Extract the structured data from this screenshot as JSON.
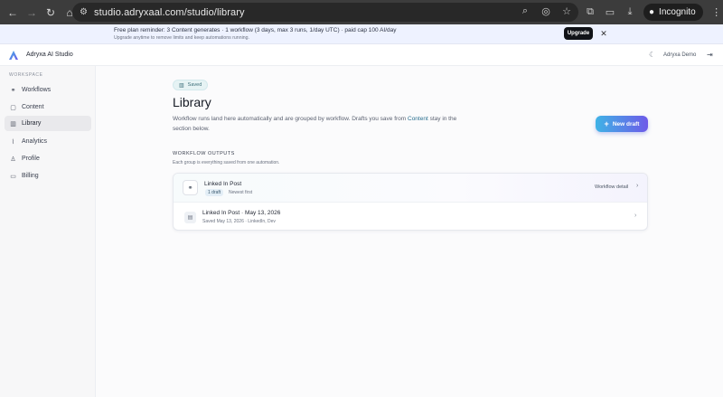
{
  "browser": {
    "url": "studio.adryxaal.com/studio/library",
    "profile_label": "Incognito"
  },
  "banner": {
    "line1": "Free plan reminder: 3 Content generates · 1 workflow (3 days, max 3 runs, 1/day UTC) · paid cap 100 AI/day",
    "line2": "Upgrade anytime to remove limits and keep automations running.",
    "upgrade_label": "Upgrade",
    "close_glyph": "✕"
  },
  "header": {
    "app_title": "Adryxa AI Studio",
    "user": "Adryxa Demo"
  },
  "sidebar": {
    "heading": "WORKSPACE",
    "items": [
      {
        "label": "Workflows",
        "icon": "link-icon"
      },
      {
        "label": "Content",
        "icon": "page-icon"
      },
      {
        "label": "Library",
        "icon": "book-icon"
      },
      {
        "label": "Analytics",
        "icon": "chart-icon"
      },
      {
        "label": "Profile",
        "icon": "person-icon"
      },
      {
        "label": "Billing",
        "icon": "card-icon"
      }
    ],
    "active": "Library"
  },
  "main": {
    "chip_label": "Saved",
    "title": "Library",
    "desc_pre": "Workflow runs land here automatically and are grouped by workflow. Drafts you save from ",
    "desc_link": "Content",
    "desc_post": " stay in the section below.",
    "new_draft_label": "New draft",
    "section_title": "WORKFLOW OUTPUTS",
    "section_sub": "Each group is everything saved from one automation.",
    "group": {
      "title": "Linked In Post",
      "badge": "1 draft",
      "sort": "Newest first",
      "detail_label": "Workflow detail",
      "items": [
        {
          "title": "Linked In Post · May 13, 2026",
          "sub": "Saved May 13, 2026 · LinkedIn, Dev"
        }
      ]
    }
  },
  "colors": {
    "accent_start": "#3fb3e6",
    "accent_end": "#6d5ae8",
    "banner_bg": "#eef2ff",
    "sidebar_active": "#e9e9ec"
  }
}
